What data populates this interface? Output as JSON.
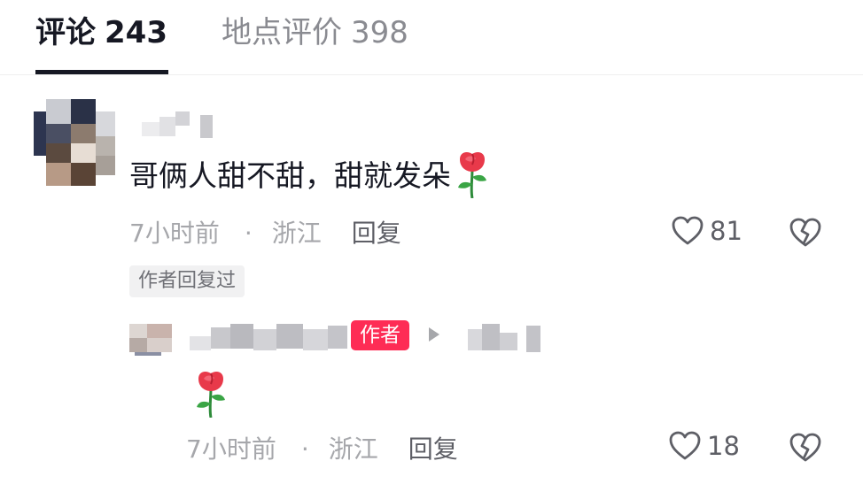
{
  "tabs": [
    {
      "label": "评论",
      "count": "243",
      "active": true
    },
    {
      "label": "地点评价",
      "count": "398",
      "active": false
    }
  ],
  "comment": {
    "text": "哥俩人甜不甜，甜就发朵",
    "emoji": "rose-emoji",
    "time": "7小时前",
    "separator": "·",
    "location": "浙江",
    "reply_label": "回复",
    "likes": "81",
    "author_replied_tag": "作者回复过"
  },
  "reply": {
    "badge": "作者",
    "emoji": "rose-emoji",
    "time": "7小时前",
    "separator": "·",
    "location": "浙江",
    "reply_label": "回复",
    "likes": "18"
  },
  "icons": {
    "like": "heart-outline-icon",
    "dislike": "broken-heart-icon",
    "reply_arrow": "triangle-right-icon"
  },
  "colors": {
    "accent": "#fe2c55",
    "primary_text": "#161823",
    "secondary_text": "#a6a7ab",
    "tag_background": "#f1f1f2"
  }
}
